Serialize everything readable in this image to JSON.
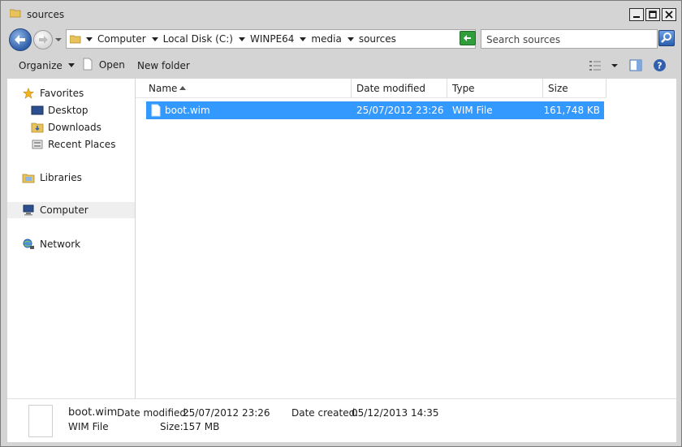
{
  "window": {
    "title": "sources"
  },
  "address": {
    "crumbs": [
      "Computer",
      "Local Disk (C:)",
      "WINPE64",
      "media",
      "sources"
    ],
    "search_placeholder": "Search sources"
  },
  "toolbar": {
    "organize": "Organize",
    "open": "Open",
    "new_folder": "New folder"
  },
  "nav": {
    "favorites": "Favorites",
    "desktop": "Desktop",
    "downloads": "Downloads",
    "recent": "Recent Places",
    "libraries": "Libraries",
    "computer": "Computer",
    "network": "Network"
  },
  "columns": {
    "name": "Name",
    "date": "Date modified",
    "type": "Type",
    "size": "Size"
  },
  "files": [
    {
      "name": "boot.wim",
      "date": "25/07/2012 23:26",
      "type": "WIM File",
      "size": "161,748 KB"
    }
  ],
  "details": {
    "name": "boot.wim",
    "type": "WIM File",
    "date_modified_label": "Date modified:",
    "date_modified": "25/07/2012 23:26",
    "size_label": "Size:",
    "size": "157 MB",
    "date_created_label": "Date created:",
    "date_created": "05/12/2013 14:35"
  },
  "colors": {
    "selection": "#3399ff",
    "chrome": "#d4d4d4"
  }
}
